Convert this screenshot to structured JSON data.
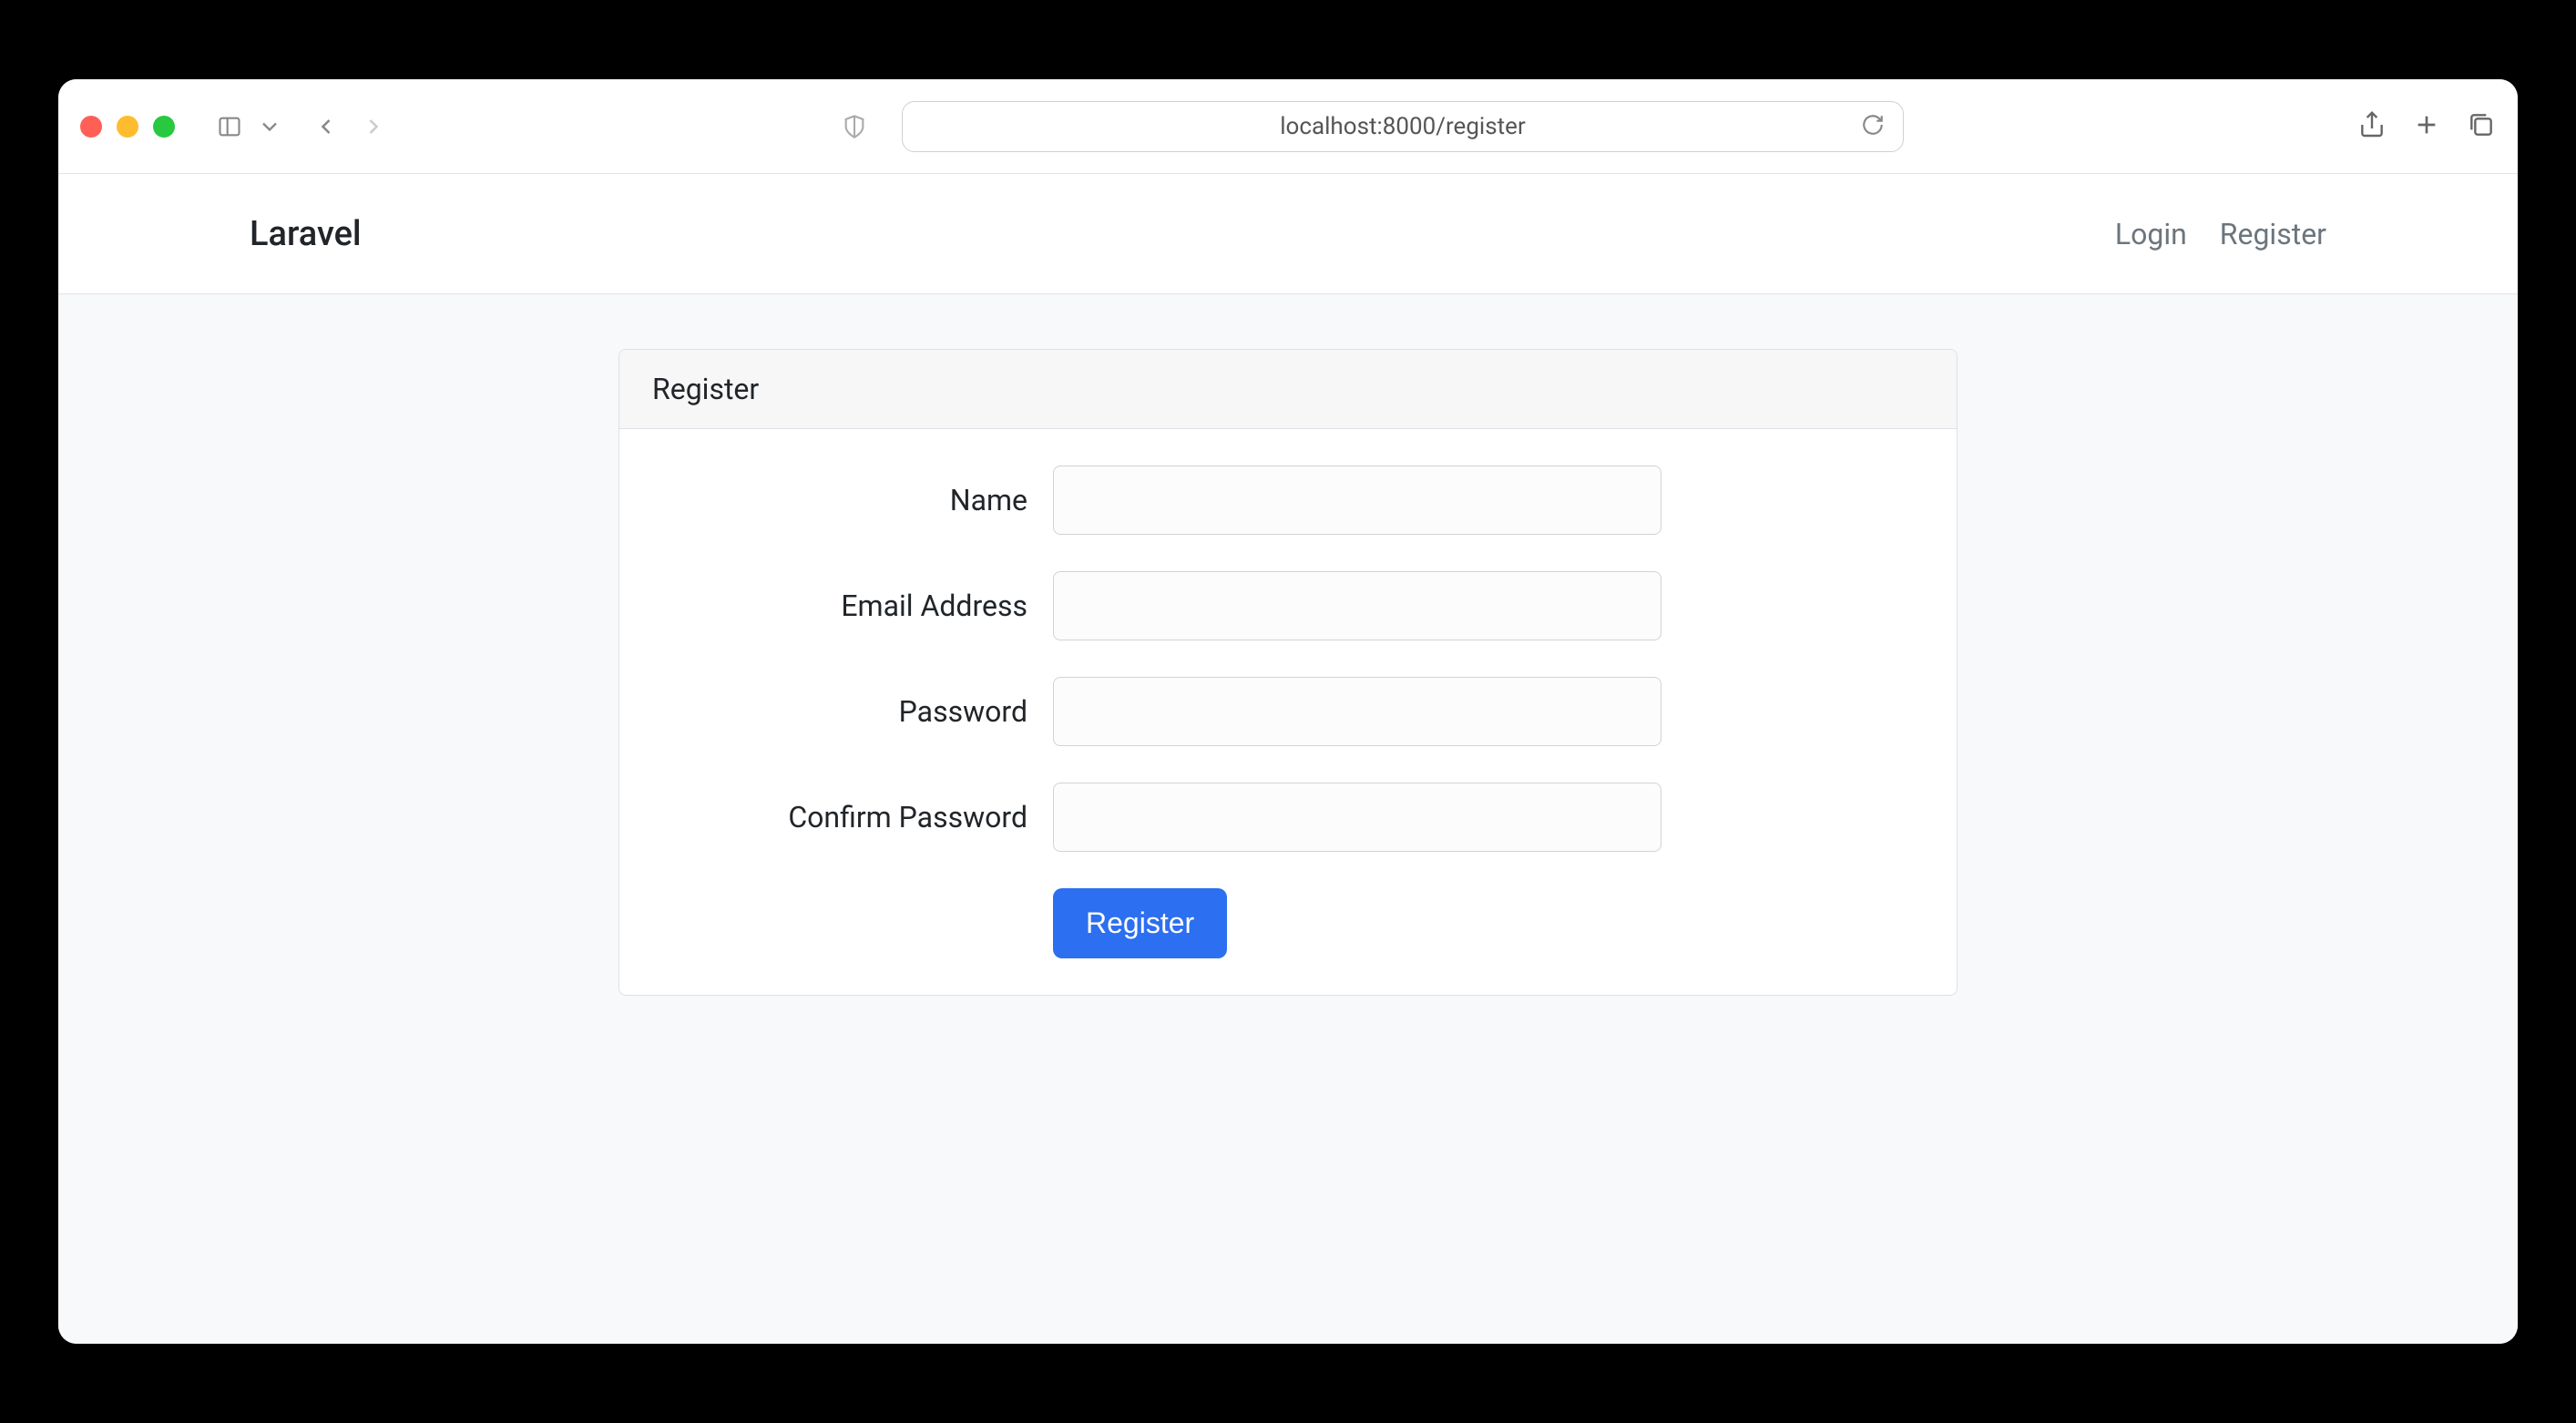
{
  "browser": {
    "url": "localhost:8000/register"
  },
  "navbar": {
    "brand": "Laravel",
    "links": {
      "login": "Login",
      "register": "Register"
    }
  },
  "card": {
    "title": "Register"
  },
  "form": {
    "name_label": "Name",
    "name_value": "",
    "email_label": "Email Address",
    "email_value": "",
    "password_label": "Password",
    "password_value": "",
    "confirm_label": "Confirm Password",
    "confirm_value": "",
    "submit_label": "Register"
  }
}
